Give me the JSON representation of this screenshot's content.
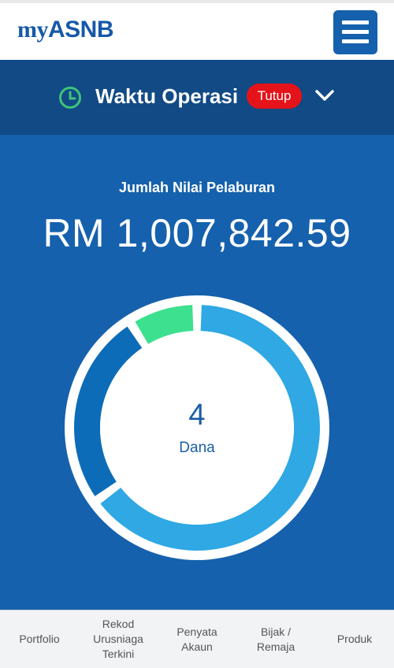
{
  "header": {
    "logo_prefix": "my",
    "logo_main": "ASNB",
    "menu_icon": "hamburger-menu-icon"
  },
  "operation": {
    "icon": "clock-icon",
    "label": "Waktu Operasi",
    "status": "Tutup",
    "status_color": "#e5131a",
    "expand_icon": "chevron-down-icon"
  },
  "summary": {
    "label": "Jumlah Nilai Pelaburan",
    "value": "RM 1,007,842.59",
    "fund_count": "4",
    "fund_label": "Dana"
  },
  "chart_data": {
    "type": "pie",
    "style": "donut",
    "slices": [
      {
        "color": "#2fa8e4",
        "fraction": 0.65
      },
      {
        "color": "#0c6cb8",
        "fraction": 0.26
      },
      {
        "color": "#3de08e",
        "fraction": 0.09
      }
    ]
  },
  "bottom_nav": {
    "items": [
      {
        "label": "Portfolio"
      },
      {
        "label": "Rekod\nUrusniaga\nTerkini"
      },
      {
        "label": "Penyata\nAkaun"
      },
      {
        "label": "Bijak /\nRemaja"
      },
      {
        "label": "Produk"
      }
    ]
  },
  "colors": {
    "brand_blue": "#1561ad",
    "dark_blue": "#114a85",
    "clock_green": "#3ec37a"
  }
}
